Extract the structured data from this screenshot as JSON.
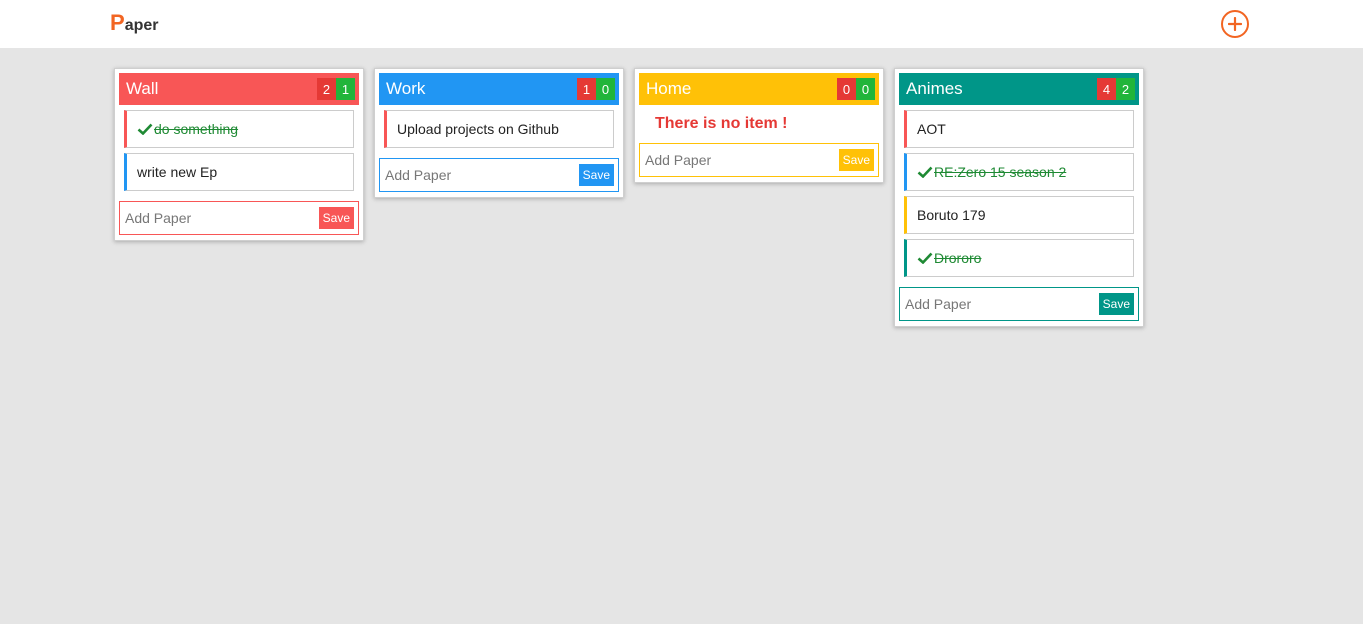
{
  "app": {
    "logo_first": "P",
    "logo_rest": "aper",
    "add_board_icon": "plus-circle-icon",
    "accent": "#f26522"
  },
  "colors": {
    "done_text": "#1f8a34",
    "pending_badge": "#e53935",
    "done_badge": "#21b53a",
    "empty_text": "#e53935"
  },
  "input_placeholder": "Add Paper",
  "save_label": "Save",
  "boards": [
    {
      "title": "Wall",
      "color": "#f85656",
      "pending": "2",
      "done": "1",
      "cards": [
        {
          "text": " do something",
          "done": true,
          "accent": "#f85656"
        },
        {
          "text": "write new Ep",
          "done": false,
          "accent": "#2196f3"
        }
      ]
    },
    {
      "title": "Work",
      "color": "#2196f3",
      "pending": "1",
      "done": "0",
      "cards": [
        {
          "text": "Upload projects on Github",
          "done": false,
          "accent": "#f85656"
        }
      ]
    },
    {
      "title": "Home",
      "color": "#ffc107",
      "pending": "0",
      "done": "0",
      "empty_message": "There is no item !",
      "cards": []
    },
    {
      "title": "Animes",
      "color": "#009688",
      "pending": "4",
      "done": "2",
      "cards": [
        {
          "text": "AOT",
          "done": false,
          "accent": "#f85656"
        },
        {
          "text": " RE:Zero 15 season 2",
          "done": true,
          "accent": "#2196f3"
        },
        {
          "text": "Boruto 179",
          "done": false,
          "accent": "#ffc107"
        },
        {
          "text": " Drororo",
          "done": true,
          "accent": "#009688"
        }
      ]
    }
  ]
}
